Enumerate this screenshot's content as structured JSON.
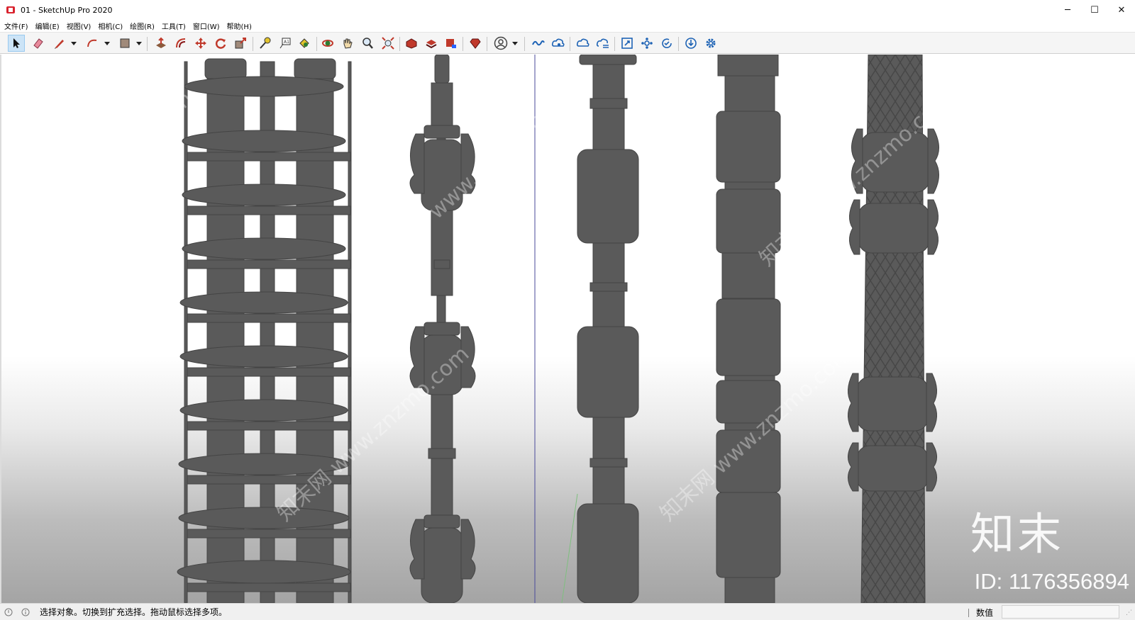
{
  "window": {
    "title": "01 - SketchUp Pro 2020",
    "icon": "sketchup-icon",
    "controls": [
      "─",
      "☐",
      "✕"
    ]
  },
  "menu": [
    "文件(F)",
    "编辑(E)",
    "视图(V)",
    "相机(C)",
    "绘图(R)",
    "工具(T)",
    "窗口(W)",
    "帮助(H)"
  ],
  "toolbar": {
    "tools": [
      "select-tool-icon",
      "eraser-tool-icon",
      "pencil-line-tool-icon",
      "arc-tool-icon",
      "rectangle-tool-icon",
      "push-pull-tool-icon",
      "offset-tool-icon",
      "move-tool-icon",
      "rotate-tool-icon",
      "scale-tool-icon",
      "tape-measure-tool-icon",
      "text-tool-icon",
      "paint-bucket-tool-icon",
      "orbit-tool-icon",
      "pan-tool-icon",
      "zoom-tool-icon",
      "zoom-extents-tool-icon",
      "3d-warehouse-icon",
      "components-icon",
      "share-model-icon",
      "extension-warehouse-icon",
      "account-icon",
      "trimble-connect-icon",
      "collaborate-icon",
      "cloud-open-icon",
      "cloud-save-icon",
      "resize-icon",
      "model-settings-icon",
      "sync-icon",
      "download-icon",
      "settings-gear-icon"
    ]
  },
  "viewport": {
    "watermark_logo": "知末",
    "watermark_id": "ID: 1176356894",
    "watermark_text": "知末网 www.znzmo.com",
    "model_color": "#5a5a5a"
  },
  "statusbar": {
    "hint": "选择对象。切换到扩充选择。拖动鼠标选择多项。",
    "measure_label": "数值",
    "measure_value": ""
  }
}
